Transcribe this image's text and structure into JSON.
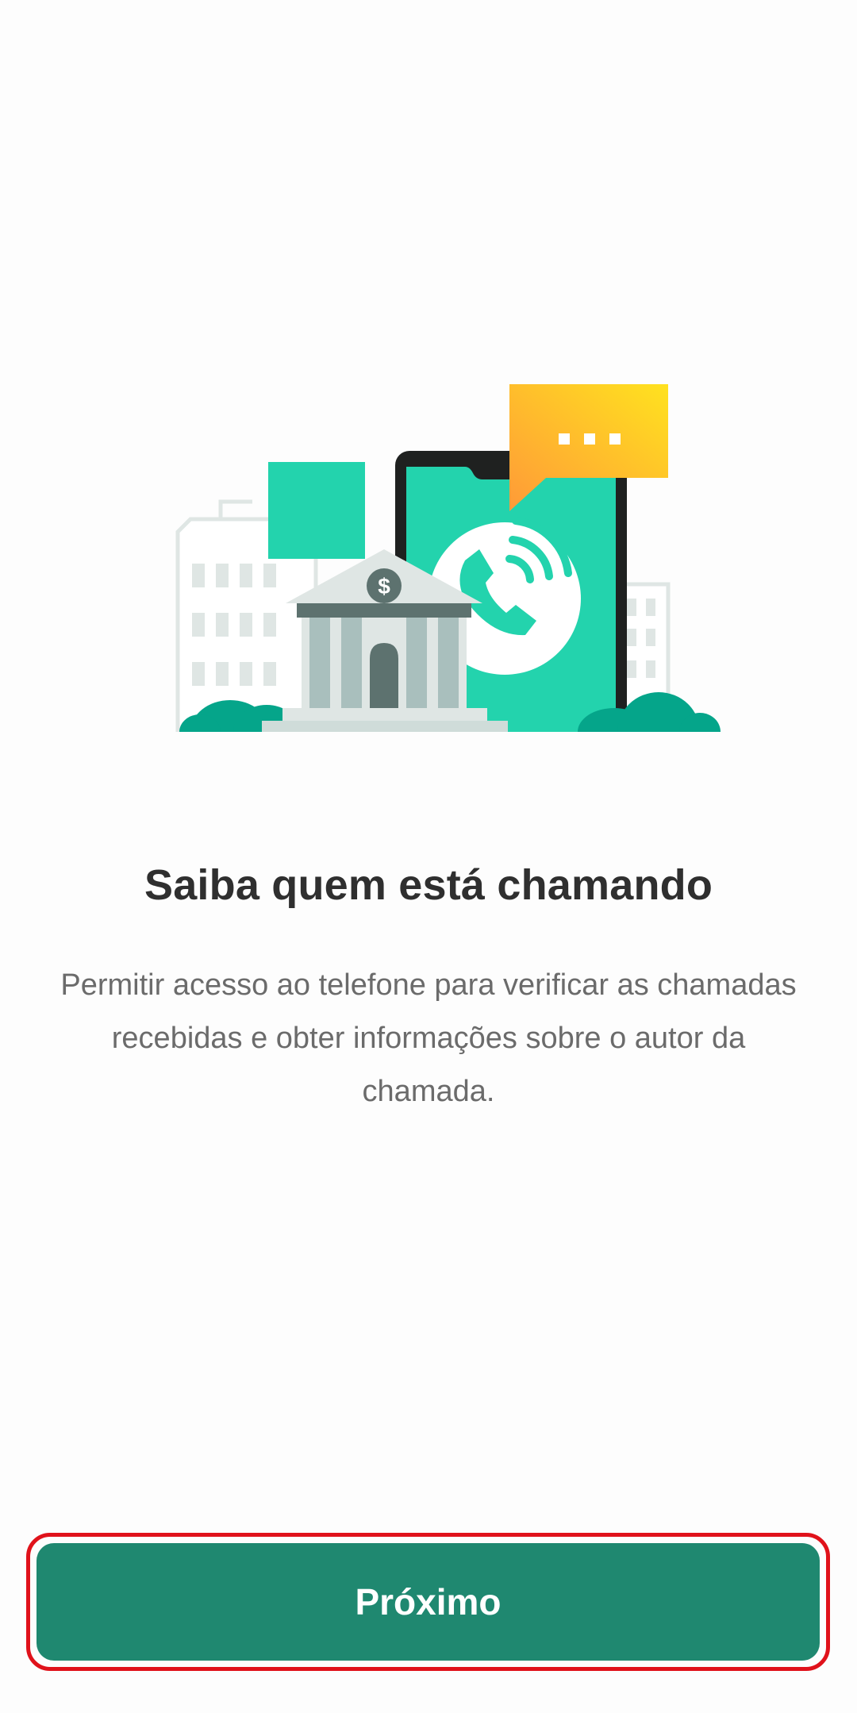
{
  "onboarding": {
    "title": "Saiba quem está chamando",
    "description": "Permitir acesso ao telefone para verificar as chamadas recebidas e obter informações sobre o autor da chamada.",
    "next_label": "Próximo"
  },
  "illustration": {
    "icons": [
      "bank-icon",
      "phone-call-icon",
      "chat-bubble-icon",
      "building-icon",
      "dollar-icon"
    ],
    "colors": {
      "teal": "#23d3ad",
      "dark_teal": "#05a58a",
      "gray_building": "#dfe6e4",
      "bank_column": "#a9bfbd",
      "phone_frame": "#1f2120",
      "bubble_start": "#ff9a38",
      "bubble_end": "#ffe21f"
    }
  },
  "colors": {
    "button": "#1f8870",
    "highlight_border": "#e0121b",
    "title": "#2f2f2f",
    "text": "#6b6b6b"
  }
}
